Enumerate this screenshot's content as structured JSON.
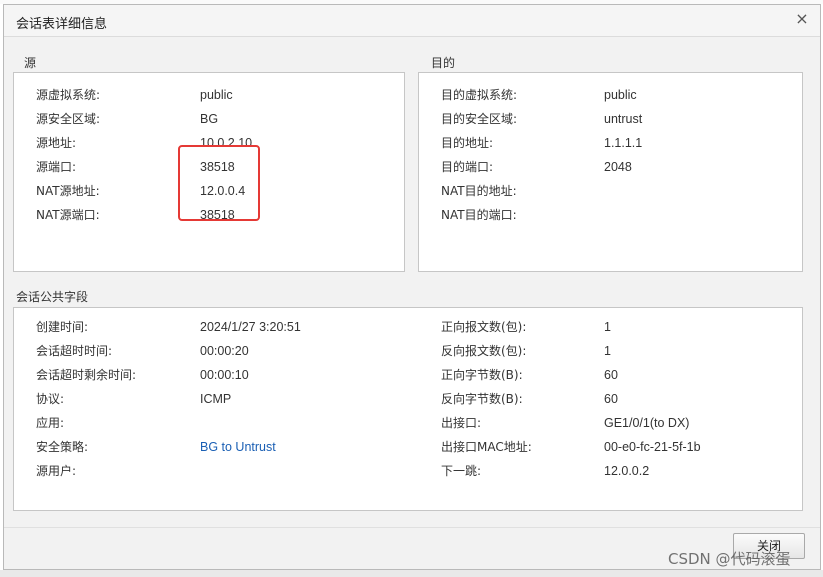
{
  "dialog": {
    "title": "会话表详细信息",
    "close_glyph": "×"
  },
  "source": {
    "section_title": "源",
    "rows": [
      {
        "label": "源虚拟系统:",
        "value": "public"
      },
      {
        "label": "源安全区域:",
        "value": "BG"
      },
      {
        "label": "源地址:",
        "value": "10.0.2.10"
      },
      {
        "label": "源端口:",
        "value": "38518"
      },
      {
        "label": "NAT源地址:",
        "value": "12.0.0.4"
      },
      {
        "label": "NAT源端口:",
        "value": "38518"
      }
    ]
  },
  "destination": {
    "section_title": "目的",
    "rows": [
      {
        "label": "目的虚拟系统:",
        "value": "public"
      },
      {
        "label": "目的安全区域:",
        "value": "untrust"
      },
      {
        "label": "目的地址:",
        "value": "1.1.1.1"
      },
      {
        "label": "目的端口:",
        "value": "2048"
      },
      {
        "label": "NAT目的地址:",
        "value": ""
      },
      {
        "label": "NAT目的端口:",
        "value": ""
      }
    ]
  },
  "common": {
    "section_title": "会话公共字段",
    "left_rows": [
      {
        "label": "创建时间:",
        "value": "2024/1/27 3:20:51"
      },
      {
        "label": "会话超时时间:",
        "value": "00:00:20"
      },
      {
        "label": "会话超时剩余时间:",
        "value": "00:00:10"
      },
      {
        "label": "协议:",
        "value": "ICMP"
      },
      {
        "label": "应用:",
        "value": ""
      },
      {
        "label": "安全策略:",
        "value": "BG to Untrust"
      },
      {
        "label": "源用户:",
        "value": ""
      }
    ],
    "right_rows": [
      {
        "label": "正向报文数(包):",
        "value": "1"
      },
      {
        "label": "反向报文数(包):",
        "value": "1"
      },
      {
        "label": "正向字节数(B):",
        "value": "60"
      },
      {
        "label": "反向字节数(B):",
        "value": "60"
      },
      {
        "label": "出接口:",
        "value": "GE1/0/1(to DX)"
      },
      {
        "label": "出接口MAC地址:",
        "value": "00-e0-fc-21-5f-1b"
      },
      {
        "label": "下一跳:",
        "value": "12.0.0.2"
      }
    ]
  },
  "footer": {
    "close_button_label": "关闭"
  },
  "watermark": {
    "text": "CSDN @代码滚蛋"
  },
  "colors": {
    "highlight": "#e53935",
    "link": "#1a5fb4"
  }
}
